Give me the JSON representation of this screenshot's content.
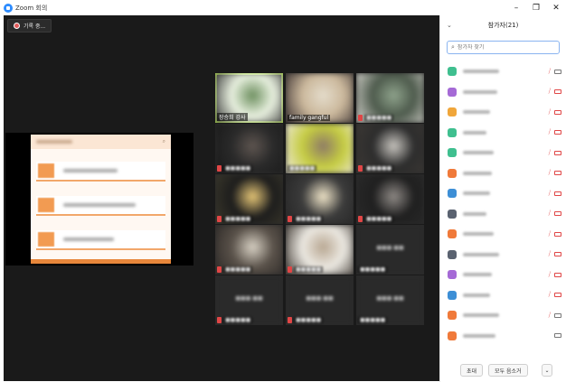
{
  "window": {
    "title": "Zoom 회의",
    "controls": {
      "minimize": "–",
      "maximize": "❐",
      "close": "✕"
    }
  },
  "recording": {
    "label": "기록 중..."
  },
  "gallery": {
    "tiles": [
      {
        "name": "장승희 강사",
        "active": true,
        "muted": false,
        "palette": [
          "#e9f1e0",
          "#6d8f5f",
          "#2f2f2f"
        ]
      },
      {
        "name": "family gangful",
        "active": false,
        "muted": false,
        "palette": [
          "#cbb89c",
          "#e4dccb",
          "#3a3030"
        ]
      },
      {
        "name": "",
        "active": false,
        "muted": true,
        "palette": [
          "#4d5a4c",
          "#8fa38c",
          "#dad8d2"
        ]
      },
      {
        "name": "",
        "active": false,
        "muted": true,
        "palette": [
          "#2a2a2a",
          "#5e5550",
          "#191919"
        ]
      },
      {
        "name": "",
        "active": false,
        "muted": false,
        "palette": [
          "#c5cc42",
          "#8e7b66",
          "#f0eae0"
        ]
      },
      {
        "name": "",
        "active": false,
        "muted": true,
        "palette": [
          "#2c2c2c",
          "#c9c6c0",
          "#3e3a36"
        ]
      },
      {
        "name": "",
        "active": false,
        "muted": true,
        "palette": [
          "#1c1c1c",
          "#e8c877",
          "#3d3a2c"
        ]
      },
      {
        "name": "",
        "active": false,
        "muted": true,
        "palette": [
          "#3b3b3b",
          "#f1e6c9",
          "#262626"
        ]
      },
      {
        "name": "",
        "active": false,
        "muted": true,
        "palette": [
          "#1f1f1f",
          "#8f8a86",
          "#2b2b2b"
        ]
      },
      {
        "name": "",
        "active": false,
        "muted": true,
        "palette": [
          "#5a524a",
          "#d8d1c4",
          "#2c2826"
        ]
      },
      {
        "name": "",
        "active": false,
        "muted": true,
        "palette": [
          "#ece9e2",
          "#b8a792",
          "#3b342e"
        ]
      },
      {
        "name": "",
        "active": false,
        "muted": false,
        "palette": [
          "#2a2a2a",
          "#2a2a2a",
          "#2a2a2a"
        ]
      },
      {
        "name": "",
        "active": false,
        "muted": true,
        "palette": [
          "#2a2a2a",
          "#2a2a2a",
          "#2a2a2a"
        ]
      },
      {
        "name": "",
        "active": false,
        "muted": true,
        "palette": [
          "#2a2a2a",
          "#2a2a2a",
          "#2a2a2a"
        ]
      },
      {
        "name": "",
        "active": false,
        "muted": false,
        "palette": [
          "#2a2a2a",
          "#2a2a2a",
          "#2a2a2a"
        ]
      }
    ]
  },
  "participants_panel": {
    "title": "참가자(21)",
    "search_placeholder": "참가자 찾기",
    "participants": [
      {
        "avatar_color": "#3fbf8f",
        "cam_off": false
      },
      {
        "avatar_color": "#a56ad6",
        "cam_off": true
      },
      {
        "avatar_color": "#f0a63a",
        "cam_off": true
      },
      {
        "avatar_color": "#3fbf8f",
        "cam_off": true
      },
      {
        "avatar_color": "#3fbf8f",
        "cam_off": true
      },
      {
        "avatar_color": "#f07a3a",
        "cam_off": true
      },
      {
        "avatar_color": "#3d8fd6",
        "cam_off": true
      },
      {
        "avatar_color": "#5a6270",
        "cam_off": true
      },
      {
        "avatar_color": "#f07a3a",
        "cam_off": true
      },
      {
        "avatar_color": "#5a6270",
        "cam_off": true
      },
      {
        "avatar_color": "#a56ad6",
        "cam_off": true
      },
      {
        "avatar_color": "#3d8fd6",
        "cam_off": true
      },
      {
        "avatar_color": "#f07a3a",
        "cam_off": false
      },
      {
        "avatar_color": "#f07a3a",
        "cam_off": false
      }
    ],
    "footer": {
      "invite": "초대",
      "mute_all": "모두 음소거",
      "more": "⌄"
    }
  },
  "colors": {
    "stage_bg": "#1a1a1a",
    "active_tile": "#b6e34e",
    "mute_red": "#e04646",
    "search_border": "#8ab4f0",
    "doc_accent": "#f29b52"
  }
}
